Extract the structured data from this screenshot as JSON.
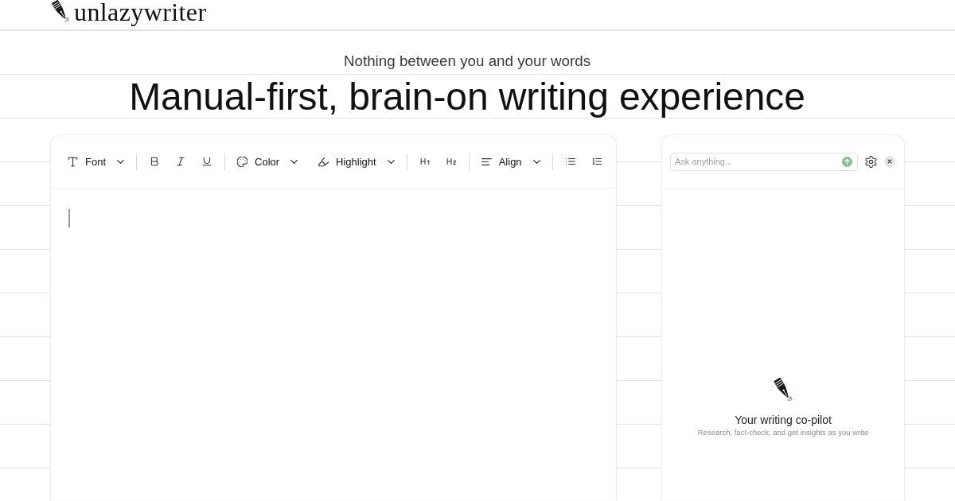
{
  "logo": {
    "text": "unlazywriter"
  },
  "hero": {
    "tagline": "Nothing between you and your words",
    "headline": "Manual-first, brain-on writing experience"
  },
  "editor": {
    "toolbar": {
      "groups": [
        [
          {
            "kind": "font",
            "label": "Font"
          }
        ],
        [
          {
            "kind": "bold"
          },
          {
            "kind": "italic"
          },
          {
            "kind": "underline"
          }
        ],
        [
          {
            "kind": "color",
            "label": "Color"
          },
          {
            "kind": "highlight",
            "label": "Highlight"
          }
        ],
        [
          {
            "kind": "heading1"
          },
          {
            "kind": "heading2"
          }
        ],
        [
          {
            "kind": "align",
            "label": "Align"
          }
        ],
        [
          {
            "kind": "bullets"
          },
          {
            "kind": "numbers"
          }
        ]
      ]
    }
  },
  "copilot": {
    "ask": {
      "placeholder": "Ask anything..."
    },
    "empty_state": {
      "title": "Your writing co-pilot",
      "text": "Research, fact-check, and get insights as you write"
    }
  }
}
